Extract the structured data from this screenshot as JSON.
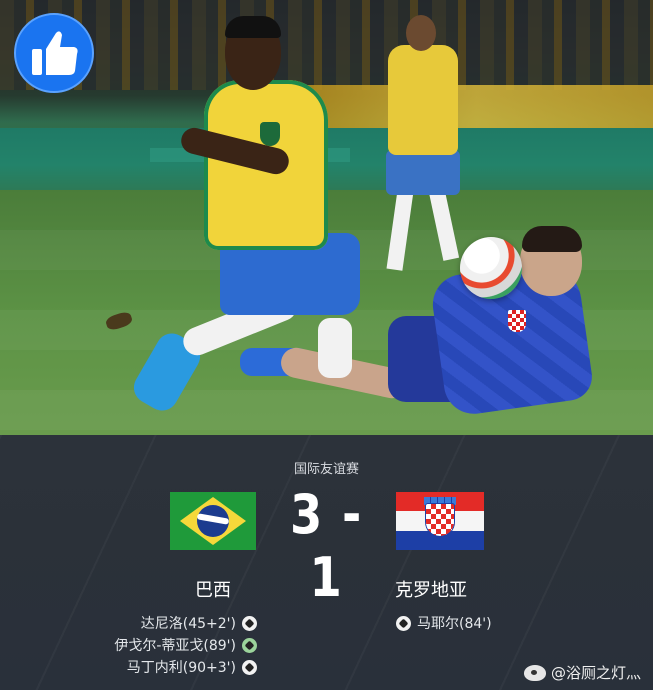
{
  "competition": "国际友谊赛",
  "score": "3 - 1",
  "home_team": {
    "name": "巴西",
    "scorers": [
      {
        "text": "达尼洛(45+2')"
      },
      {
        "text": "伊戈尔-蒂亚戈(89')"
      },
      {
        "text": "马丁内利(90+3')"
      }
    ]
  },
  "away_team": {
    "name": "克罗地亚",
    "scorers": [
      {
        "text": "马耶尔(84')"
      }
    ]
  },
  "watermark": "@浴厕之灯灬",
  "icons": {
    "like": "thumbs-up-icon",
    "goal": "soccer-ball-icon",
    "weibo": "weibo-icon"
  },
  "colors": {
    "like_button": "#1a74f0",
    "panel_bg": "#2b3139",
    "text": "#ffffff"
  }
}
